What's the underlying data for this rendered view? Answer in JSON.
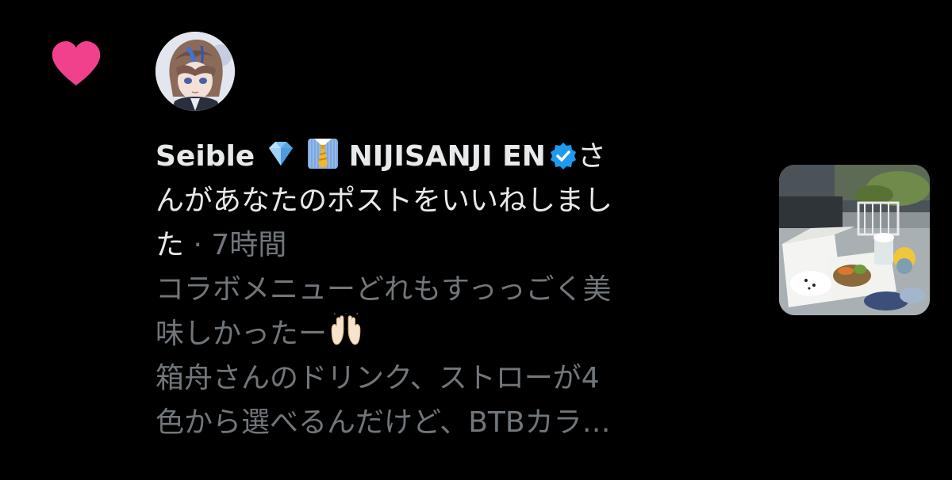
{
  "notification": {
    "actor_name": "Seible",
    "actor_emoji_1": "gem-icon",
    "actor_emoji_2": "necktie-icon",
    "actor_org": "NIJISANJI EN",
    "action_text_1": "さ",
    "action_text_2": "んがあなたのポストをいいねしまし",
    "action_text_3": "た",
    "separator": " · ",
    "timestamp": "7時間",
    "post_lines": [
      "コラボメニューどれもすっっごく美",
      "味しかったー",
      "箱舟さんのドリンク、ストローが4",
      "色から選べるんだけど、BTBカラ…"
    ],
    "post_emoji": "raising-hands-icon"
  },
  "colors": {
    "heart": "#f2418c",
    "verified": "#1d9bf0",
    "text_primary": "#e7e9ea",
    "text_muted": "#71767b",
    "background": "#000000"
  }
}
